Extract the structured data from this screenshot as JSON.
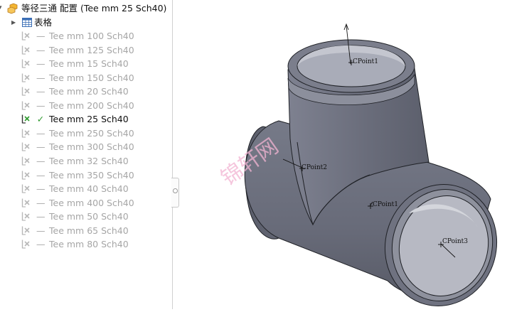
{
  "tree": {
    "root_label": "等径三通 配置 (Tee mm 25 Sch40)",
    "table_label": "表格",
    "configurations": [
      {
        "label": "Tee mm 100 Sch40",
        "active": false
      },
      {
        "label": "Tee mm 125 Sch40",
        "active": false
      },
      {
        "label": "Tee mm 15 Sch40",
        "active": false
      },
      {
        "label": "Tee mm 150 Sch40",
        "active": false
      },
      {
        "label": "Tee mm 20 Sch40",
        "active": false
      },
      {
        "label": "Tee mm 200 Sch40",
        "active": false
      },
      {
        "label": "Tee mm 25 Sch40",
        "active": true
      },
      {
        "label": "Tee mm 250 Sch40",
        "active": false
      },
      {
        "label": "Tee mm 300 Sch40",
        "active": false
      },
      {
        "label": "Tee mm 32 Sch40",
        "active": false
      },
      {
        "label": "Tee mm 350 Sch40",
        "active": false
      },
      {
        "label": "Tee mm 40 Sch40",
        "active": false
      },
      {
        "label": "Tee mm 400 Sch40",
        "active": false
      },
      {
        "label": "Tee mm 50 Sch40",
        "active": false
      },
      {
        "label": "Tee mm 65 Sch40",
        "active": false
      },
      {
        "label": "Tee mm 80 Sch40",
        "active": false
      }
    ],
    "inactive_mark": "—",
    "active_mark": "✓"
  },
  "viewport": {
    "points": {
      "p1": "CPoint1",
      "p2": "CPoint2",
      "p1b": "CPoint1",
      "p3": "CPoint3"
    },
    "watermark": "锦轩网"
  },
  "colors": {
    "active_check": "#2e9a2e",
    "inactive_text": "#a6a6a6",
    "part_body": "#6e7180",
    "watermark": "#f2b4d2"
  },
  "icons": {
    "root": "part-configurations-icon",
    "table": "table-icon",
    "config": "configuration-icon"
  }
}
